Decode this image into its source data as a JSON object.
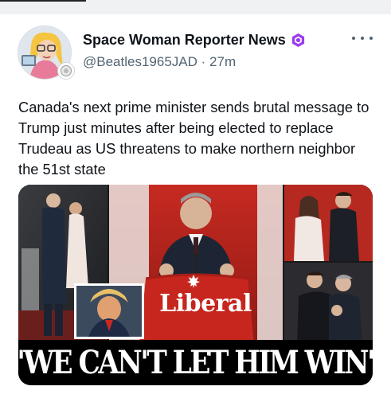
{
  "post": {
    "author": {
      "display_name": "Space Woman Reporter News",
      "handle": "@Beatles1965JAD",
      "time": "27m",
      "separator": "·"
    },
    "text": "Canada's next prime minister sends brutal message to Trump just minutes after being elected to replace Trudeau as US threatens to make northern neighbor the 51st state",
    "media": {
      "podium_sign": "Liberal",
      "headline": "'WE CAN'T LET HIM WIN'"
    }
  },
  "icons": {
    "verified": "verified-hexagon-icon",
    "more": "more-options-icon",
    "maple_leaf": "maple-leaf-icon"
  },
  "colors": {
    "verified": "#9b3cf0",
    "secondary_text": "#536471",
    "liberal_red": "#d52b1e"
  }
}
